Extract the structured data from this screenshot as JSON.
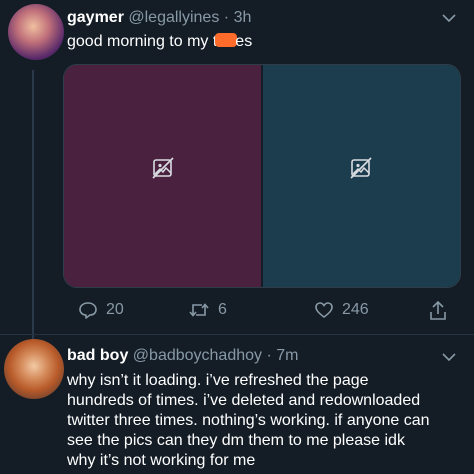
{
  "tweet1": {
    "name": "gaymer",
    "handle": "@legallyines",
    "separator": "·",
    "time": "3h",
    "text_before": "good morning to my t",
    "text_after": "es",
    "redaction_color": "#ff6b2b",
    "media": [
      {
        "icon": "broken-image-icon",
        "color": "#4a2240"
      },
      {
        "icon": "broken-image-icon",
        "color": "#1c3d4d"
      }
    ],
    "actions": {
      "reply_count": "20",
      "retweet_count": "6",
      "like_count": "246"
    }
  },
  "tweet2": {
    "name": "bad boy",
    "handle": "@badboychadhoy",
    "separator": "·",
    "time": "7m",
    "lines": [
      "why isn’t it loading. i’ve refreshed the page",
      "hundreds of times. i’ve deleted and redownloaded",
      "twitter three times. nothing’s working. if anyone can",
      "see the pics can they dm them to me please idk",
      "why it’s not working for me"
    ]
  }
}
